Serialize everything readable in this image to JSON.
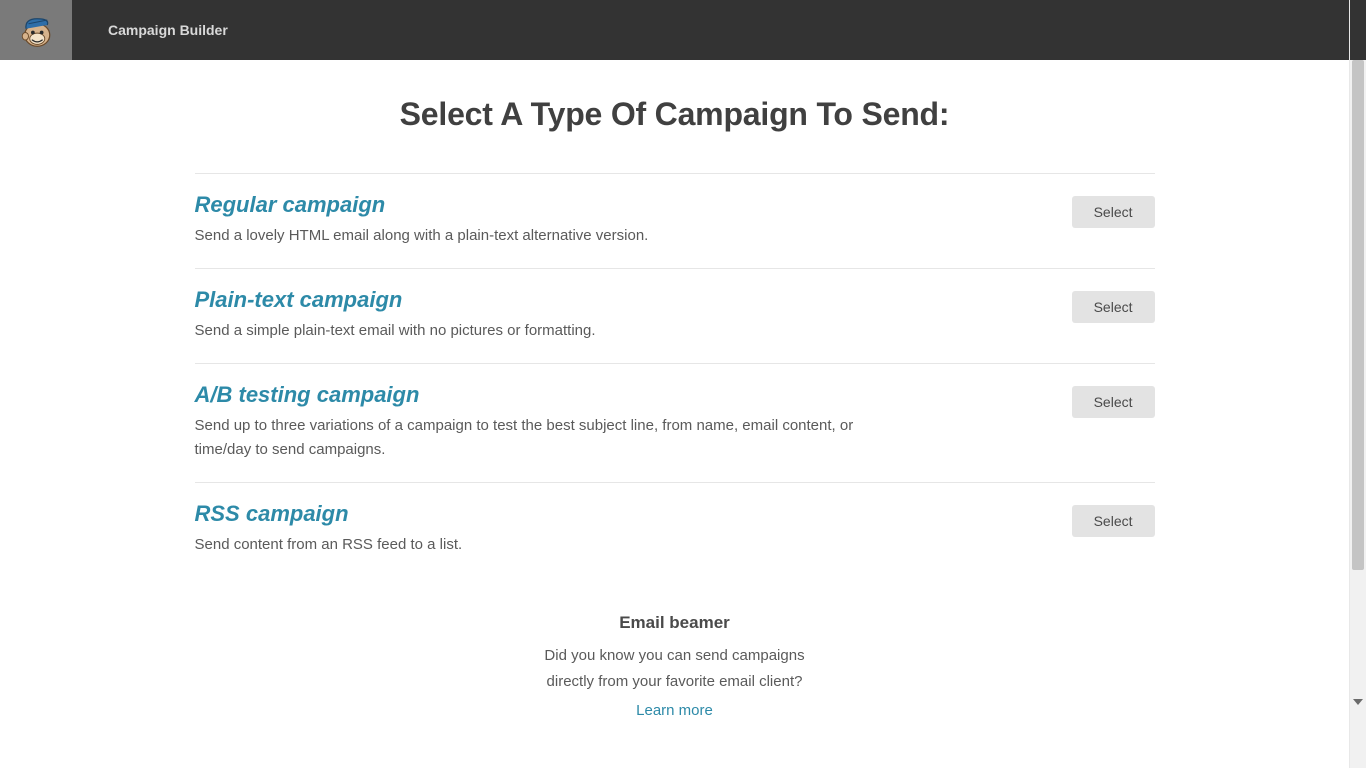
{
  "header": {
    "breadcrumb": "Campaign Builder"
  },
  "page": {
    "title": "Select A Type Of Campaign To Send:"
  },
  "options": [
    {
      "title": "Regular campaign",
      "desc": "Send a lovely HTML email along with a plain-text alternative version.",
      "button": "Select"
    },
    {
      "title": "Plain-text campaign",
      "desc": "Send a simple plain-text email with no pictures or formatting.",
      "button": "Select"
    },
    {
      "title": "A/B testing campaign",
      "desc": "Send up to three variations of a campaign to test the best subject line, from name, email content, or time/day to send campaigns.",
      "button": "Select"
    },
    {
      "title": "RSS campaign",
      "desc": "Send content from an RSS feed to a list.",
      "button": "Select"
    }
  ],
  "beamer": {
    "title": "Email beamer",
    "line1": "Did you know you can send campaigns",
    "line2": "directly from your favorite email client?",
    "link": "Learn more"
  }
}
